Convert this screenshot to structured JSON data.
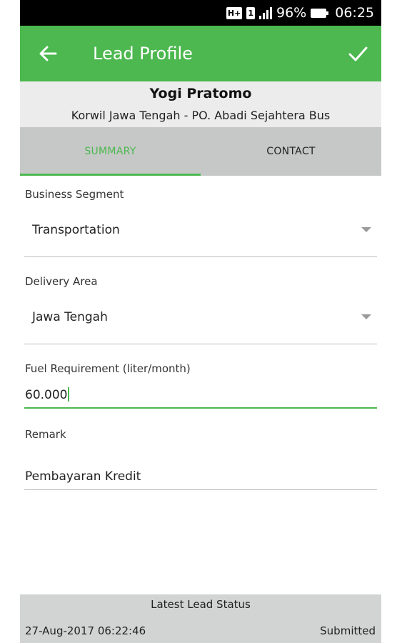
{
  "status_bar": {
    "network_type": "H+",
    "sim_slot": "1",
    "battery_percent": "96%",
    "time": "06:25"
  },
  "app_bar": {
    "title": "Lead Profile",
    "back_icon": "arrow-left-icon",
    "confirm_icon": "check-icon"
  },
  "lead": {
    "name": "Yogi Pratomo",
    "subtitle": "Korwil Jawa Tengah - PO. Abadi Sejahtera Bus"
  },
  "tabs": [
    {
      "label": "SUMMARY",
      "active": true
    },
    {
      "label": "CONTACT",
      "active": false
    }
  ],
  "form": {
    "business_segment": {
      "label": "Business Segment",
      "value": "Transportation"
    },
    "delivery_area": {
      "label": "Delivery Area",
      "value": "Jawa Tengah"
    },
    "fuel_requirement": {
      "label": "Fuel Requirement (liter/month)",
      "value": "60.000"
    },
    "remark": {
      "label": "Remark",
      "value": "Pembayaran Kredit"
    }
  },
  "footer": {
    "title": "Latest Lead Status",
    "date": "27-Aug-2017  06:22:46",
    "status": "Submitted"
  },
  "colors": {
    "accent": "#4cb84f",
    "tab_bar": "#c6c8c7",
    "header_bg": "#ececec",
    "footer_bg": "#d2d4d3"
  }
}
